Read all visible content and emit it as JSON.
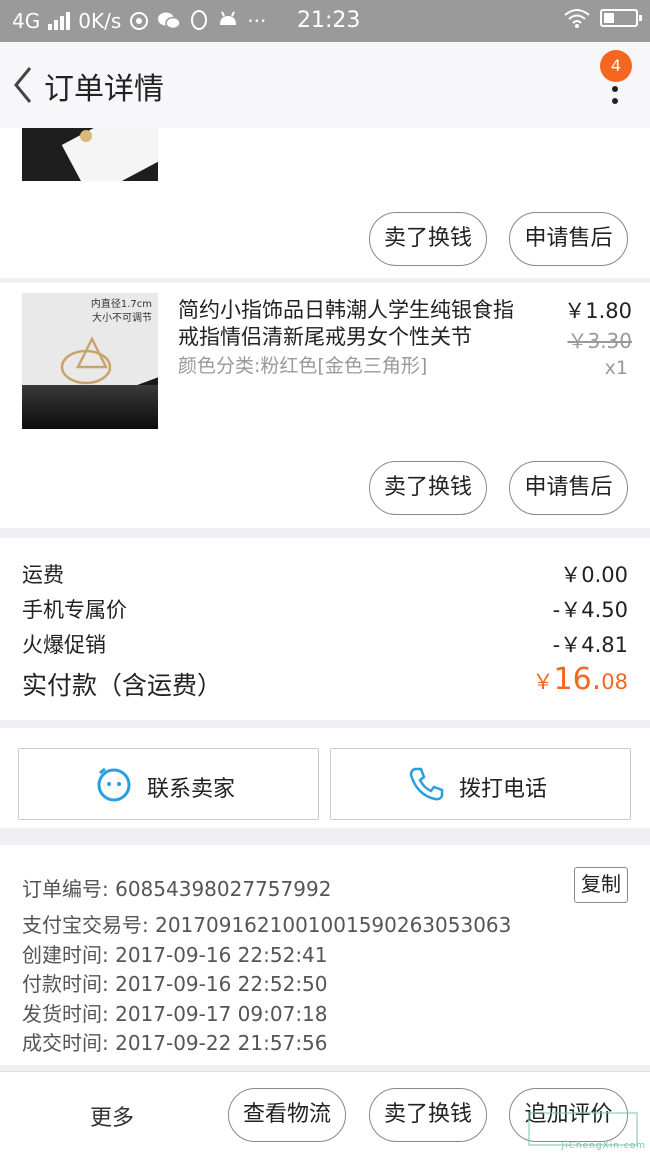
{
  "status_bar": {
    "network": "4G",
    "speed": "0K/s",
    "time": "21:23"
  },
  "nav": {
    "title": "订单详情",
    "badge_count": "4"
  },
  "order_items": [
    {
      "actions": [
        "卖了换钱",
        "申请售后"
      ]
    },
    {
      "image_caption_1": "内直径1.7cm",
      "image_caption_2": "大小不可调节",
      "name": "简约小指饰品日韩潮人学生纯银食指戒指情侣清新尾戒男女个性关节",
      "sku": "颜色分类:粉红色[金色三角形]",
      "price": "￥1.80",
      "original_price": "￥3.30",
      "quantity": "x1",
      "actions": [
        "卖了换钱",
        "申请售后"
      ]
    }
  ],
  "summary": {
    "shipping_label": "运费",
    "shipping_value": "￥0.00",
    "mobile_price_label": "手机专属价",
    "mobile_price_value": "-￥4.50",
    "promo_label": "火爆促销",
    "promo_value": "-￥4.81",
    "total_label": "实付款（含运费）",
    "total_currency": "￥",
    "total_integer": "16.",
    "total_decimal": "08"
  },
  "contact": {
    "seller_label": "联系卖家",
    "phone_label": "拨打电话"
  },
  "order_info": {
    "order_no": "订单编号: 608543980277579​92",
    "copy_label": "复制",
    "alipay_no": "支付宝交易号: 2017091621001001590263053063",
    "created": "创建时间: 2017-09-16 22:52:41",
    "paid": "付款时间: 2017-09-16 22:52:50",
    "shipped": "发货时间: 2017-09-17 09:07:18",
    "completed": "成交时间: 2017-09-22 21:57:56"
  },
  "bottom_bar": {
    "more_label": "更多",
    "logistics_label": "查看物流",
    "resell_label": "卖了换钱",
    "review_label": "追加评价"
  },
  "watermark": {
    "text": "JiChengXin.com"
  },
  "colors": {
    "accent": "#f5671f",
    "icon_blue": "#2a9fe0",
    "status_bar": "#9a9a9a"
  }
}
